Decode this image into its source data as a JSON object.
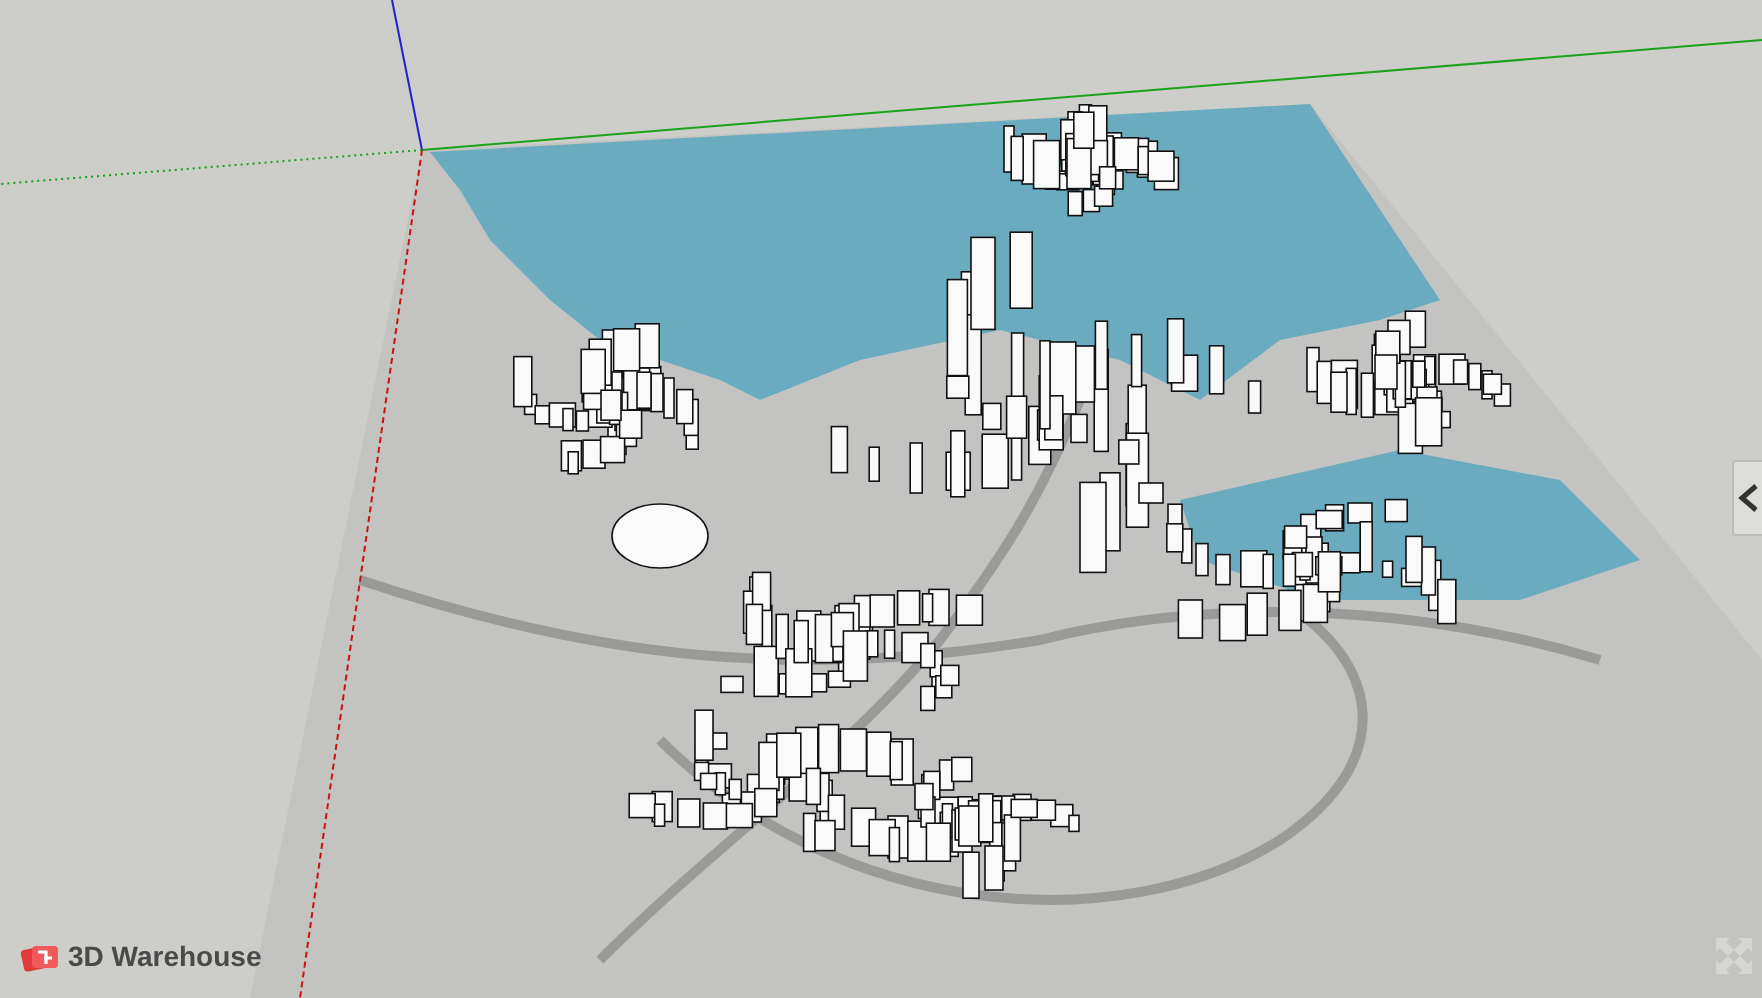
{
  "viewport": {
    "watermark_logo": {
      "text": "3D Warehouse"
    },
    "side_panel_toggle": {
      "expanded": false
    }
  }
}
